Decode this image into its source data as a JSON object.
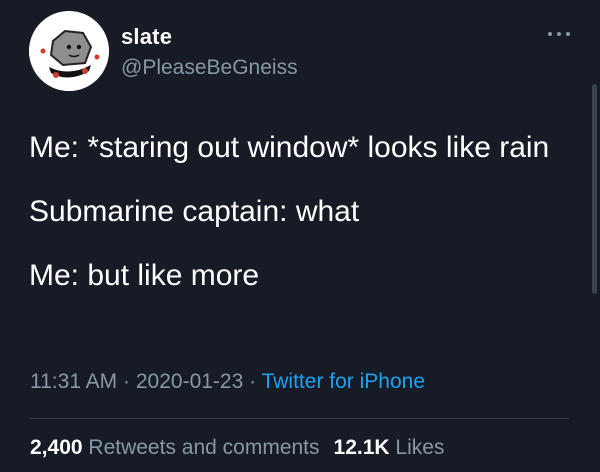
{
  "user": {
    "display_name": "slate",
    "handle": "@PleaseBeGneiss"
  },
  "tweet": {
    "lines": [
      "Me: *staring out window* looks like rain",
      "Submarine captain: what",
      "Me: but like more"
    ]
  },
  "meta": {
    "time": "11:31 AM",
    "separator": "·",
    "date": "2020-01-23",
    "source": "Twitter for iPhone"
  },
  "stats": {
    "retweets_count": "2,400",
    "retweets_label": "Retweets and comments",
    "likes_count": "12.1K",
    "likes_label": "Likes"
  },
  "colors": {
    "background": "#161b25",
    "secondary_text": "#8899a6",
    "link": "#1da1f2"
  },
  "icons": {
    "more": "more-horizontal-icon",
    "avatar": "rock-cartoon-avatar"
  }
}
